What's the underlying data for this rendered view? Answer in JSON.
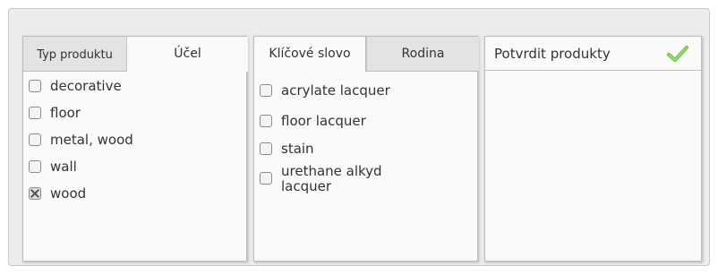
{
  "panel1": {
    "tabs": [
      {
        "label": "Typ produktu",
        "active": false
      },
      {
        "label": "Účel",
        "active": true
      }
    ],
    "items": [
      {
        "label": "decorative",
        "checked": false
      },
      {
        "label": "floor",
        "checked": false
      },
      {
        "label": "metal, wood",
        "checked": false
      },
      {
        "label": "wall",
        "checked": false
      },
      {
        "label": "wood",
        "checked": true
      }
    ]
  },
  "panel2": {
    "tabs": [
      {
        "label": "Klíčové slovo",
        "active": true
      },
      {
        "label": "Rodina",
        "active": false
      }
    ],
    "items": [
      {
        "label": "acrylate lacquer",
        "checked": false
      },
      {
        "label": "floor lacquer",
        "checked": false
      },
      {
        "label": "stain",
        "checked": false
      },
      {
        "label": "urethane alkyd lacquer",
        "checked": false
      }
    ]
  },
  "panel3": {
    "title": "Potvrdit produkty",
    "icon": "checkmark-icon",
    "icon_color": "#6cbf3c"
  }
}
